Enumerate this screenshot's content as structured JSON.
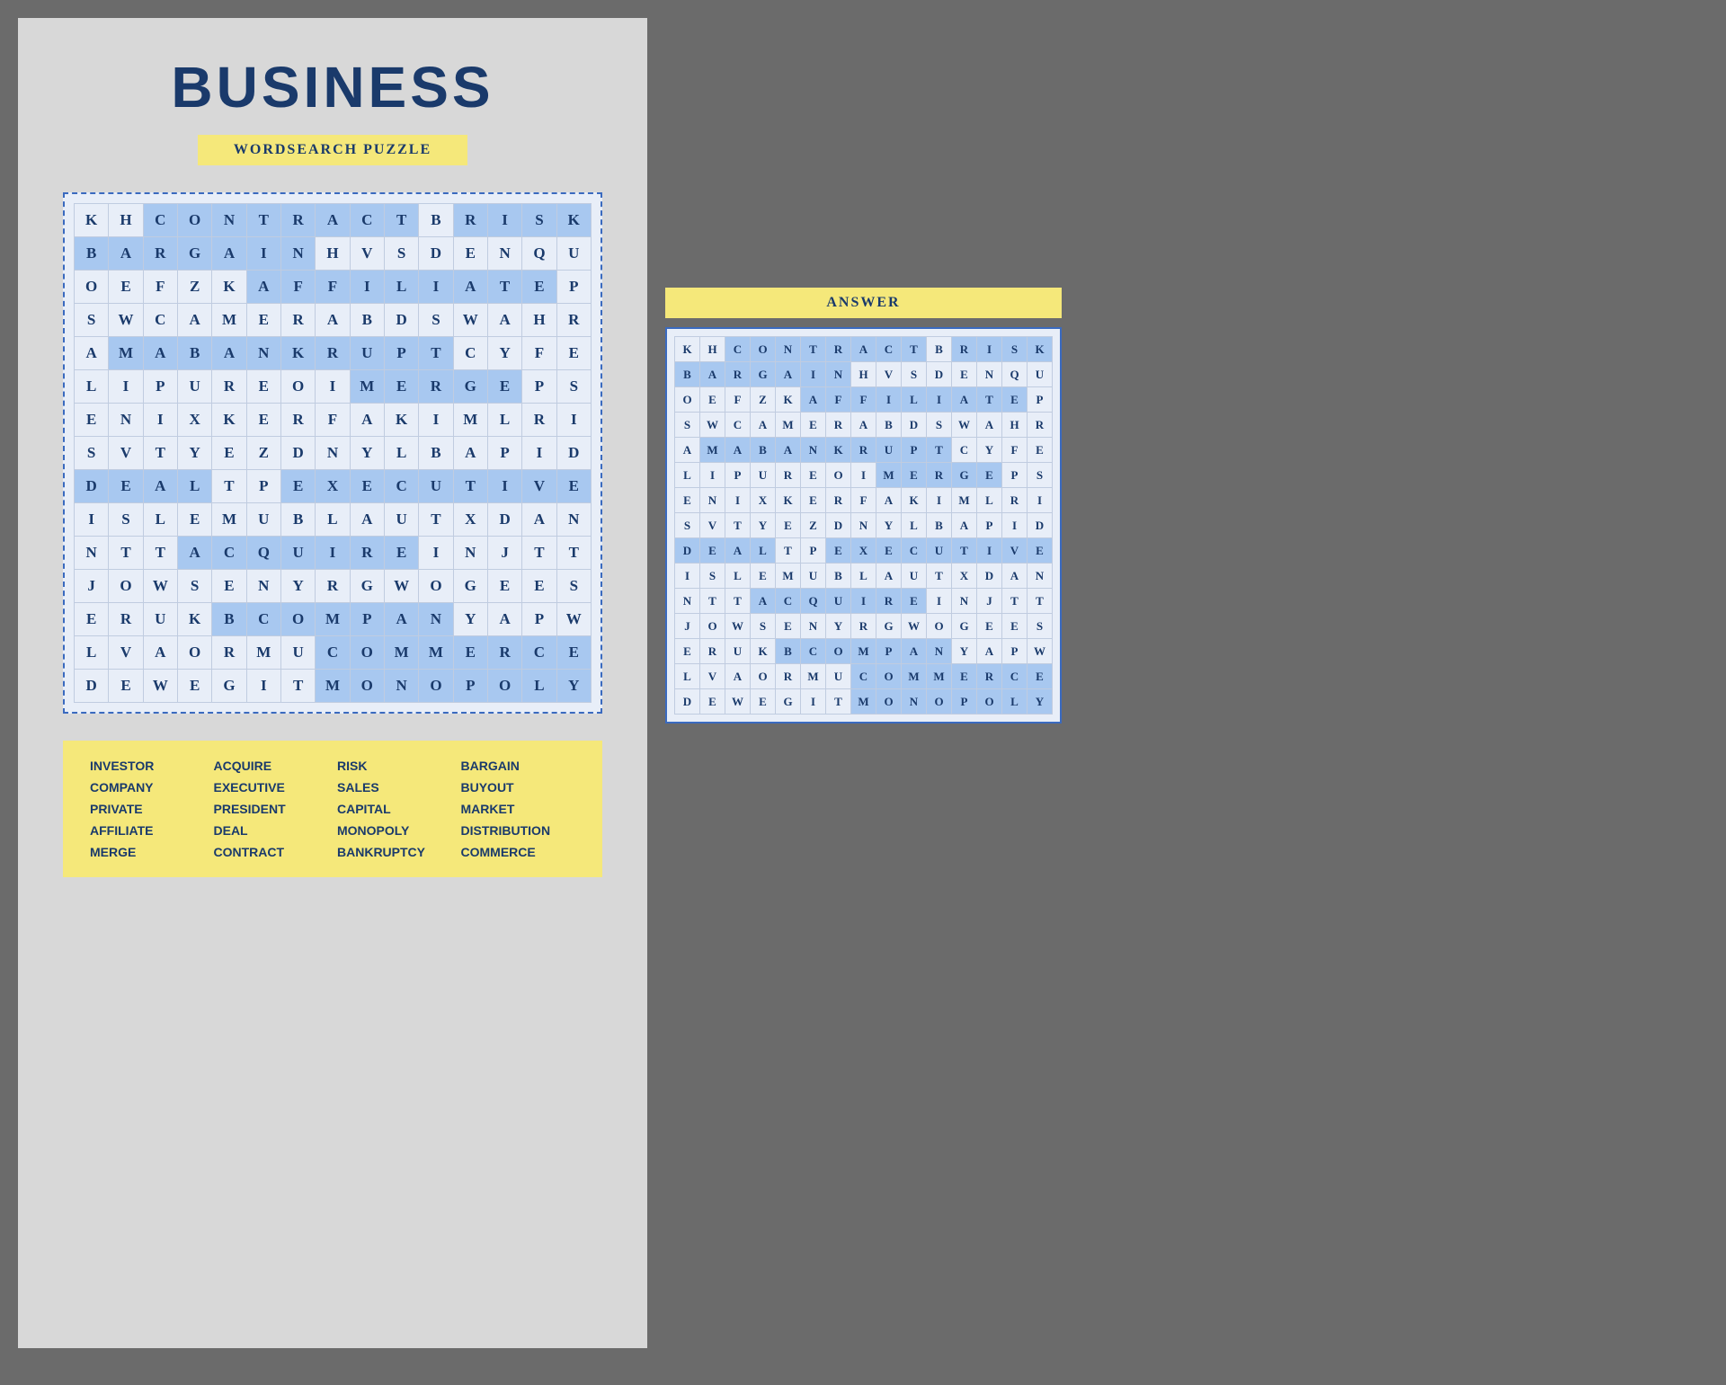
{
  "left": {
    "title": "BUSINESS",
    "subtitle": "WORDSEARCH PUZZLE",
    "grid": [
      [
        "K",
        "H",
        "C",
        "O",
        "N",
        "T",
        "R",
        "A",
        "C",
        "T",
        "B",
        "R",
        "I",
        "S",
        "K"
      ],
      [
        "B",
        "A",
        "R",
        "G",
        "A",
        "I",
        "N",
        "H",
        "V",
        "S",
        "D",
        "E",
        "N",
        "Q",
        "U"
      ],
      [
        "O",
        "E",
        "F",
        "Z",
        "K",
        "A",
        "F",
        "F",
        "I",
        "L",
        "I",
        "A",
        "T",
        "E",
        "P"
      ],
      [
        "S",
        "W",
        "C",
        "A",
        "M",
        "E",
        "R",
        "A",
        "B",
        "D",
        "S",
        "W",
        "A",
        "H",
        "R"
      ],
      [
        "A",
        "M",
        "A",
        "B",
        "A",
        "N",
        "K",
        "R",
        "U",
        "P",
        "T",
        "C",
        "Y",
        "F",
        "E"
      ],
      [
        "L",
        "I",
        "P",
        "U",
        "R",
        "E",
        "O",
        "I",
        "M",
        "E",
        "R",
        "G",
        "E",
        "P",
        "S"
      ],
      [
        "E",
        "N",
        "I",
        "X",
        "K",
        "E",
        "R",
        "F",
        "A",
        "K",
        "I",
        "M",
        "L",
        "R",
        "I"
      ],
      [
        "S",
        "V",
        "T",
        "Y",
        "E",
        "Z",
        "D",
        "N",
        "Y",
        "L",
        "B",
        "A",
        "P",
        "I",
        "D"
      ],
      [
        "D",
        "E",
        "A",
        "L",
        "T",
        "P",
        "E",
        "X",
        "E",
        "C",
        "U",
        "T",
        "I",
        "V",
        "E"
      ],
      [
        "I",
        "S",
        "L",
        "E",
        "M",
        "U",
        "B",
        "L",
        "A",
        "U",
        "T",
        "X",
        "D",
        "A",
        "N"
      ],
      [
        "N",
        "T",
        "T",
        "A",
        "C",
        "Q",
        "U",
        "I",
        "R",
        "E",
        "I",
        "N",
        "J",
        "T",
        "T"
      ],
      [
        "J",
        "O",
        "W",
        "S",
        "E",
        "N",
        "Y",
        "R",
        "G",
        "W",
        "O",
        "G",
        "E",
        "E",
        "S"
      ],
      [
        "E",
        "R",
        "U",
        "K",
        "B",
        "C",
        "O",
        "M",
        "P",
        "A",
        "N",
        "Y",
        "A",
        "P",
        "W"
      ],
      [
        "L",
        "V",
        "A",
        "O",
        "R",
        "M",
        "U",
        "C",
        "O",
        "M",
        "M",
        "E",
        "R",
        "C",
        "E"
      ],
      [
        "D",
        "E",
        "W",
        "E",
        "G",
        "I",
        "T",
        "M",
        "O",
        "N",
        "O",
        "P",
        "O",
        "L",
        "Y"
      ]
    ],
    "highlights": {
      "CONTRACT": [
        [
          0,
          2
        ],
        [
          0,
          3
        ],
        [
          0,
          4
        ],
        [
          0,
          5
        ],
        [
          0,
          6
        ],
        [
          0,
          7
        ],
        [
          0,
          8
        ],
        [
          0,
          9
        ]
      ],
      "RISK": [
        [
          0,
          11
        ],
        [
          0,
          12
        ],
        [
          0,
          13
        ],
        [
          0,
          14
        ]
      ],
      "BARGAIN": [
        [
          1,
          0
        ],
        [
          1,
          1
        ],
        [
          1,
          2
        ],
        [
          1,
          3
        ],
        [
          1,
          4
        ],
        [
          1,
          5
        ],
        [
          1,
          6
        ]
      ],
      "AFFILIATE": [
        [
          2,
          5
        ],
        [
          2,
          6
        ],
        [
          2,
          7
        ],
        [
          2,
          8
        ],
        [
          2,
          9
        ],
        [
          2,
          10
        ],
        [
          2,
          11
        ],
        [
          2,
          12
        ],
        [
          2,
          13
        ]
      ],
      "BANKRUPTCY": [
        [
          4,
          1
        ],
        [
          4,
          2
        ],
        [
          4,
          3
        ],
        [
          4,
          4
        ],
        [
          4,
          5
        ],
        [
          4,
          6
        ],
        [
          4,
          7
        ],
        [
          4,
          8
        ],
        [
          4,
          9
        ],
        [
          4,
          10
        ]
      ],
      "MERGE": [
        [
          5,
          8
        ],
        [
          5,
          9
        ],
        [
          5,
          10
        ],
        [
          5,
          11
        ],
        [
          5,
          12
        ]
      ],
      "DEAL": [
        [
          8,
          0
        ],
        [
          8,
          1
        ],
        [
          8,
          2
        ],
        [
          8,
          3
        ]
      ],
      "EXECUTIVE": [
        [
          8,
          6
        ],
        [
          8,
          7
        ],
        [
          8,
          8
        ],
        [
          8,
          9
        ],
        [
          8,
          10
        ],
        [
          8,
          11
        ],
        [
          8,
          12
        ],
        [
          8,
          13
        ],
        [
          8,
          14
        ]
      ],
      "ACQUIRE": [
        [
          10,
          3
        ],
        [
          10,
          4
        ],
        [
          10,
          5
        ],
        [
          10,
          6
        ],
        [
          10,
          7
        ],
        [
          10,
          8
        ],
        [
          10,
          9
        ]
      ],
      "COMPANY": [
        [
          12,
          4
        ],
        [
          12,
          5
        ],
        [
          12,
          6
        ],
        [
          12,
          7
        ],
        [
          12,
          8
        ],
        [
          12,
          9
        ],
        [
          12,
          10
        ]
      ],
      "COMMERCE": [
        [
          13,
          7
        ],
        [
          13,
          8
        ],
        [
          13,
          9
        ],
        [
          13,
          10
        ],
        [
          13,
          11
        ],
        [
          13,
          12
        ],
        [
          13,
          13
        ],
        [
          13,
          14
        ]
      ],
      "MONOPOLY": [
        [
          14,
          7
        ],
        [
          14,
          8
        ],
        [
          14,
          9
        ],
        [
          14,
          10
        ],
        [
          14,
          11
        ],
        [
          14,
          12
        ],
        [
          14,
          13
        ],
        [
          14,
          14
        ]
      ]
    },
    "words": [
      "INVESTOR",
      "ACQUIRE",
      "RISK",
      "BARGAIN",
      "COMPANY",
      "EXECUTIVE",
      "SALES",
      "BUYOUT",
      "PRIVATE",
      "PRESIDENT",
      "CAPITAL",
      "MARKET",
      "AFFILIATE",
      "DEAL",
      "MONOPOLY",
      "DISTRIBUTION",
      "MERGE",
      "CONTRACT",
      "BANKRUPTCY",
      "COMMERCE"
    ]
  },
  "right": {
    "answer_title": "ANSWER"
  }
}
